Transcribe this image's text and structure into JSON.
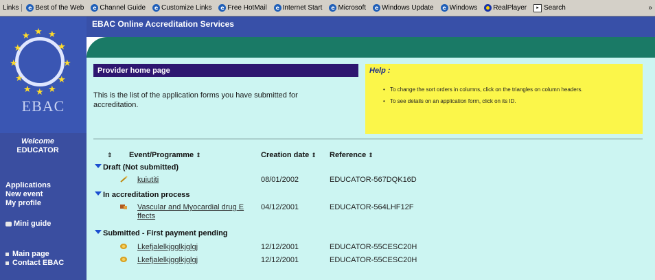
{
  "links_bar": {
    "label": "Links",
    "items": [
      "Best of the Web",
      "Channel Guide",
      "Customize Links",
      "Free HotMail",
      "Internet Start",
      "Microsoft",
      "Windows Update",
      "Windows",
      "RealPlayer",
      "Search"
    ],
    "chevron": "»"
  },
  "sidebar": {
    "logo_text": "EBAC",
    "welcome_line1": "Welcome",
    "welcome_line2": "EDUCATOR",
    "nav": {
      "applications": "Applications",
      "new_event": "New event",
      "my_profile": "My profile",
      "mini_guide": "Mini guide",
      "main_page": "Main page",
      "contact": "Contact EBAC"
    }
  },
  "header": {
    "title": "EBAC Online Accreditation Services"
  },
  "provider": {
    "title": "Provider home page",
    "intro": "This is the list of the application forms you have submitted for accreditation."
  },
  "help": {
    "title": "Help :",
    "items": [
      "To change the sort orders in columns, click on the triangles on column headers.",
      "To see details on an application form, click on its ID."
    ]
  },
  "table": {
    "columns": {
      "event": "Event/Programme",
      "creation": "Creation date",
      "reference": "Reference"
    },
    "sort_icon": "⇕",
    "groups": [
      {
        "name": "Draft (Not submitted)",
        "rows": [
          {
            "event": "kuiutiti",
            "date": "08/01/2002",
            "ref": "EDUCATOR-567DQK16D",
            "icon": "pencil-icon"
          }
        ]
      },
      {
        "name": "In accreditation process",
        "rows": [
          {
            "event_line1": "Vascular and Myocardial drug E",
            "event_line2": "ffects",
            "date": "04/12/2001",
            "ref": "EDUCATOR-564LHF12F",
            "icon": "process-icon"
          }
        ]
      },
      {
        "name": "Submitted - First payment pending",
        "rows": [
          {
            "event": "Lkefjalelkjgglkjglgj",
            "date": "12/12/2001",
            "ref": "EDUCATOR-55CESC20H",
            "icon": "payment-icon"
          },
          {
            "event": "Lkefjalelkjgglkjglgj",
            "date": "12/12/2001",
            "ref": "EDUCATOR-55CESC20H",
            "icon": "payment-icon"
          }
        ]
      }
    ]
  },
  "colors": {
    "sidebar": "#3a4ea0",
    "main_bg": "#ccf5f2",
    "help_bg": "#fbf64a",
    "title_bar": "#2e1770",
    "green_band": "#1a7a66",
    "group_triangle": "#1b4fd0"
  }
}
